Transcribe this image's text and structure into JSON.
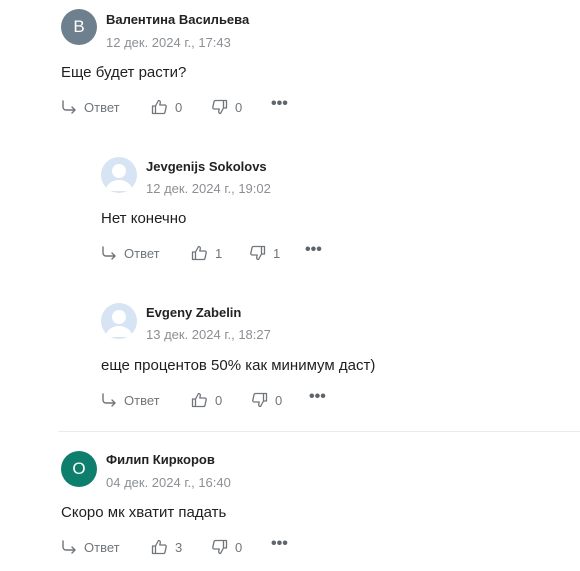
{
  "comments": [
    {
      "avatar_letter": "B",
      "author": "Валентина Васильева",
      "date": "12 дек. 2024 г., 17:43",
      "text": "Еще будет расти?",
      "reply_label": "Ответ",
      "likes": "0",
      "dislikes": "0"
    },
    {
      "avatar_letter": "",
      "author": "Jevgenijs Sokolovs",
      "date": "12 дек. 2024 г., 19:02",
      "text": "Нет конечно",
      "reply_label": "Ответ",
      "likes": "1",
      "dislikes": "1"
    },
    {
      "avatar_letter": "",
      "author": "Evgeny Zabelin",
      "date": "13 дек. 2024 г., 18:27",
      "text": "еще процентов 50% как минимум даст)",
      "reply_label": "Ответ",
      "likes": "0",
      "dislikes": "0"
    },
    {
      "avatar_letter": "О",
      "author": "Филип Киркоров",
      "date": "04 дек. 2024 г., 16:40",
      "text": "Скоро мк хватит падать",
      "reply_label": "Ответ",
      "likes": "3",
      "dislikes": "0"
    }
  ],
  "colors": {
    "avatar_gray": "#6e7f8d",
    "avatar_green": "#0f7f6d",
    "avatar_photo_bg": "#d6e4f3",
    "meta_gray": "#8b8f94"
  },
  "icons": {
    "reply": "reply-arrow-icon",
    "like": "thumbs-up-icon",
    "dislike": "thumbs-down-icon",
    "more": "more-dots-icon"
  },
  "more_label": "•••"
}
